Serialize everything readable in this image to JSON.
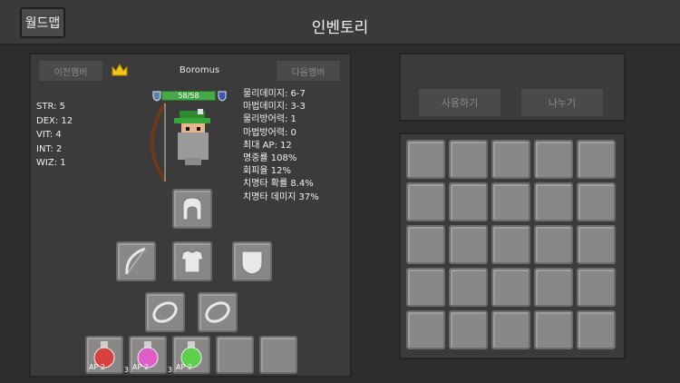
{
  "header": {
    "title": "인벤토리",
    "worldmap_label": "월드맵"
  },
  "character": {
    "prev_label": "이전멤버",
    "next_label": "다음멤버",
    "name": "Boromus",
    "hp_text": "58/58",
    "hp_fraction": 1.0,
    "stats": [
      "STR: 5",
      "DEX: 12",
      "VIT: 4",
      "INT: 2",
      "WIZ: 1"
    ],
    "derived": [
      "물리데미지: 6-7",
      "마법데미지: 3-3",
      "물리방어력: 1",
      "마법방어력: 0",
      "최대 AP: 12",
      "명중률 108%",
      "회피율 12%",
      "치명타 확률 8.4%",
      "치명타 데미지 37%"
    ]
  },
  "equipment": {
    "helmet": "helmet-icon",
    "weapon": "bow-icon",
    "armor": "armor-icon",
    "shield": "shield-icon",
    "ring1": "ring-icon",
    "ring2": "ring-icon"
  },
  "quickslots": [
    {
      "icon": "red-potion-icon",
      "ap": "AP 2",
      "count": "3",
      "color": "#d94040"
    },
    {
      "icon": "pink-potion-icon",
      "ap": "AP 2",
      "count": "3",
      "color": "#e05cc8"
    },
    {
      "icon": "green-potion-icon",
      "ap": "AP 2",
      "count": "",
      "color": "#5cd04a"
    },
    {
      "icon": "",
      "ap": "",
      "count": ""
    },
    {
      "icon": "",
      "ap": "",
      "count": ""
    }
  ],
  "actions": {
    "use_label": "사용하기",
    "split_label": "나누기"
  },
  "colors": {
    "hp_bar": "#47a84a",
    "slot": "#8a8787",
    "panel": "#3b3b3b"
  }
}
